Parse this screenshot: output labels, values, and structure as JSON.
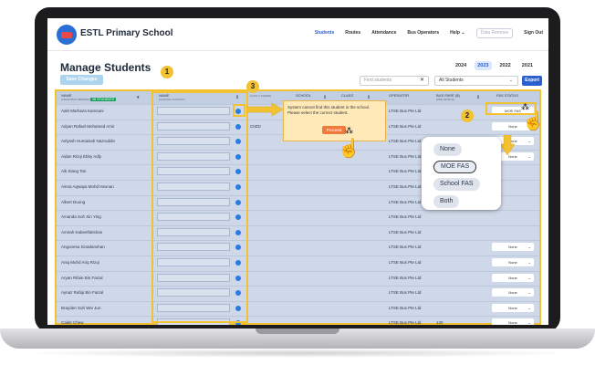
{
  "header": {
    "school_name": "ESTL Primary School",
    "nav": [
      "Students",
      "Routes",
      "Attendance",
      "Bus Operators",
      "Help ⌄",
      "Data Remove",
      "Sign Out"
    ]
  },
  "page": {
    "title": "Manage Students",
    "years": [
      "2024",
      "2023",
      "2022",
      "2021"
    ],
    "selected_year": "2023",
    "save_label": "Save Changes",
    "search_placeholder": "Find students",
    "filter_value": "All Students",
    "export_label": "Export"
  },
  "table": {
    "headers": {
      "name": "NAME",
      "name_sub": "(FROM BUS VENDOR)",
      "count": "96 STUDENTS",
      "school_name": "NAME",
      "school_name_sub": "(SCHOOL COCKPIT)",
      "col3": "",
      "col3_sub": "(LAST 4 CHARS)",
      "school": "SCHOOL",
      "class": "CLASS",
      "operator": "OPERATOR",
      "fare": "BUS FARE ($)",
      "fare_sub": "(PER MONTH)",
      "fas": "FAS STATUS"
    },
    "rows": [
      {
        "name": "Adel Marhaza Kamsani",
        "col3": "",
        "operator": "LTSE Bus Pte Ltd",
        "fare": "",
        "fas": "MOE FAS"
      },
      {
        "name": "Adyan Rafael Mohamed Amir",
        "col3": "C0ZD",
        "operator": "LTSE Bus Pte Ltd",
        "fare": "",
        "fas": "None"
      },
      {
        "name": "Aelyssh Humaisah Nazruddin",
        "col3": "",
        "operator": "LTSE Bus Pte Ltd",
        "fare": "",
        "fas": "None"
      },
      {
        "name": "Aidan Rizqi Ebby Adly",
        "col3": "",
        "operator": "LTSE Bus Pte Ltd",
        "fare": "",
        "fas": "None"
      },
      {
        "name": "Aik Siang Tan",
        "col3": "",
        "operator": "LTSE Bus Pte Ltd",
        "fare": "",
        "fas": ""
      },
      {
        "name": "Ainna Aqwaya Mohd Hexnan",
        "col3": "",
        "operator": "LTSE Bus Pte Ltd",
        "fare": "",
        "fas": ""
      },
      {
        "name": "Albert Duong",
        "col3": "",
        "operator": "LTSE Bus Pte Ltd",
        "fare": "",
        "fas": ""
      },
      {
        "name": "Amanda Soh Xin Ying",
        "col3": "",
        "operator": "LTSE Bus Pte Ltd",
        "fare": "",
        "fas": ""
      },
      {
        "name": "Amirah Kabeelfatishan",
        "col3": "",
        "operator": "LTSE Bus Pte Ltd",
        "fare": "",
        "fas": ""
      },
      {
        "name": "Angunesa Sinadanshan",
        "col3": "",
        "operator": "LTSE Bus Pte Ltd",
        "fare": "",
        "fas": "None"
      },
      {
        "name": "Aniq Muhd Ariq Rizqi",
        "col3": "",
        "operator": "LTSE Bus Pte Ltd",
        "fare": "",
        "fas": "None"
      },
      {
        "name": "Aryan Rifaie Bin Faizal",
        "col3": "",
        "operator": "LTSE Bus Pte Ltd",
        "fare": "",
        "fas": "None"
      },
      {
        "name": "Aynaz Rafiqi Bin Faizal",
        "col3": "",
        "operator": "LTSE Bus Pte Ltd",
        "fare": "",
        "fas": "None"
      },
      {
        "name": "Brayden Soh Wei Jun",
        "col3": "",
        "operator": "LTSE Bus Pte Ltd",
        "fare": "",
        "fas": "None"
      },
      {
        "name": "Caleb Chew",
        "col3": "",
        "operator": "LTSE Bus Pte Ltd",
        "fare": "130",
        "fas": "None"
      }
    ]
  },
  "tooltip": {
    "message": "System cannot find this student in the school. Please select the correct student.",
    "button": "Proceed"
  },
  "popover": {
    "options": [
      "None",
      "MOE FAS",
      "School FAS",
      "Both"
    ],
    "selected": "MOE FAS"
  },
  "steps": [
    "1",
    "2",
    "3"
  ],
  "colors": {
    "highlight": "#f2c233",
    "primary": "#2b5fd0",
    "table_bg": "#cfd8e8"
  }
}
